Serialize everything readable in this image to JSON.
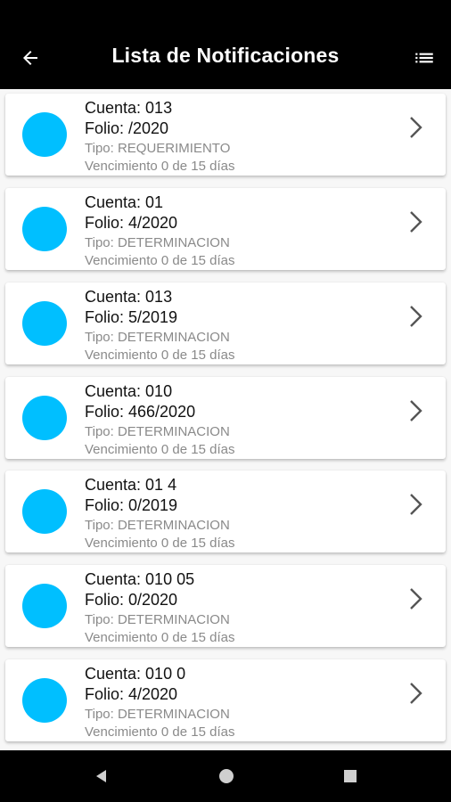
{
  "header": {
    "title": "Lista de Notificaciones",
    "back_icon": "arrow-left-icon",
    "menu_icon": "list-icon"
  },
  "colors": {
    "topbar": "#000000",
    "accent_dot": "#00bfff",
    "primary_text": "#111111",
    "secondary_text": "#8a8a8a"
  },
  "notifications": [
    {
      "cuenta": "Cuenta: 013",
      "folio": "Folio: /2020",
      "tipo": "Tipo: REQUERIMIENTO",
      "vencimiento": "Vencimiento 0 de 15 días"
    },
    {
      "cuenta": "Cuenta: 01",
      "folio": "Folio: 4/2020",
      "tipo": "Tipo: DETERMINACION",
      "vencimiento": "Vencimiento 0 de 15 días"
    },
    {
      "cuenta": "Cuenta: 013",
      "folio": "Folio: 5/2019",
      "tipo": "Tipo: DETERMINACION",
      "vencimiento": "Vencimiento 0 de 15 días"
    },
    {
      "cuenta": "Cuenta: 010",
      "folio": "Folio: 466/2020",
      "tipo": "Tipo: DETERMINACION",
      "vencimiento": "Vencimiento 0 de 15 días"
    },
    {
      "cuenta": "Cuenta: 01          4",
      "folio": "Folio:       0/2019",
      "tipo": "Tipo: DETERMINACION",
      "vencimiento": "Vencimiento 0 de 15 días"
    },
    {
      "cuenta": "Cuenta: 010          05",
      "folio": "Folio:  0/2020",
      "tipo": "Tipo: DETERMINACION",
      "vencimiento": "Vencimiento 0 de 15 días"
    },
    {
      "cuenta": "Cuenta: 010          0",
      "folio": "Folio: 4/2020",
      "tipo": "Tipo: DETERMINACION",
      "vencimiento": "Vencimiento 0 de 15 días"
    }
  ],
  "navigation": {
    "back": "triangle-back-icon",
    "home": "circle-home-icon",
    "recents": "square-recents-icon"
  }
}
